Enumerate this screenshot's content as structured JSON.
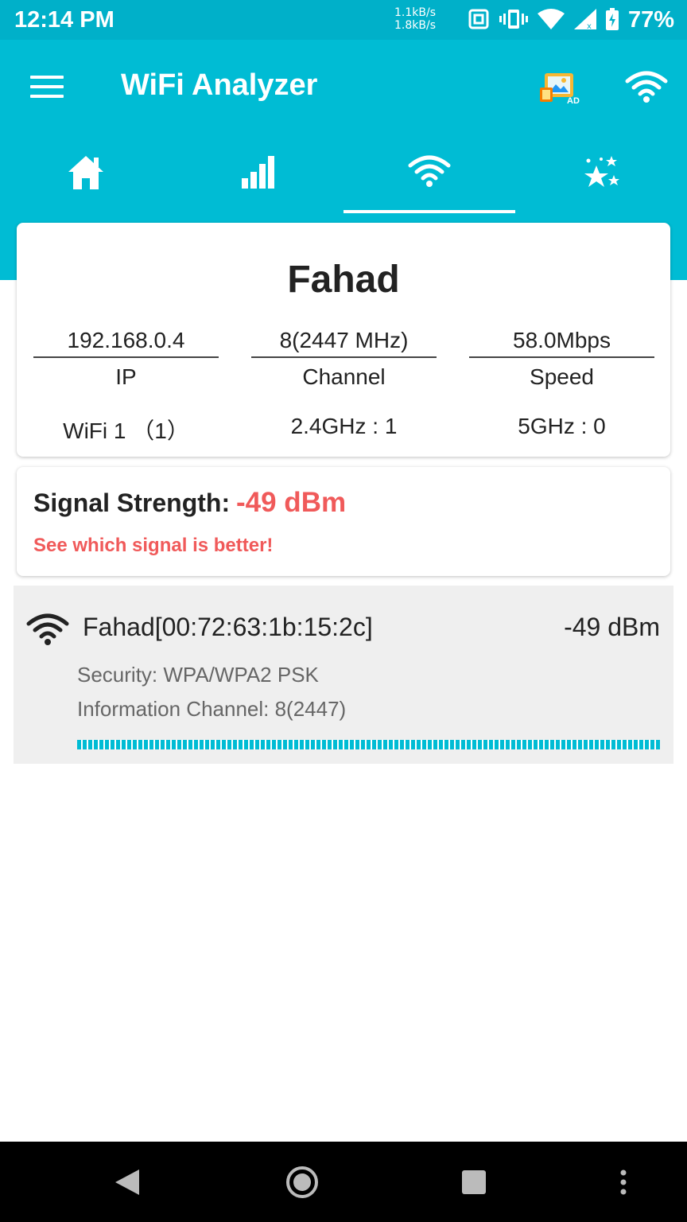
{
  "status_bar": {
    "time": "12:14 PM",
    "up_rate": "1.1kB/s",
    "down_rate": "1.8kB/s",
    "battery_percent": "77%",
    "icons": [
      "nfc-icon",
      "vibrate-icon",
      "wifi-signal-icon",
      "cell-signal-icon",
      "battery-icon"
    ]
  },
  "app_bar": {
    "title": "WiFi Analyzer",
    "ad_badge": "AD",
    "color": "#00bcd4"
  },
  "tabs": [
    {
      "name": "home",
      "icon": "home-icon"
    },
    {
      "name": "signal",
      "icon": "bar-chart-icon"
    },
    {
      "name": "wifi",
      "icon": "wifi-icon",
      "selected": true
    },
    {
      "name": "rate",
      "icon": "stars-icon"
    }
  ],
  "connection": {
    "ssid": "Fahad",
    "ip": "192.168.0.4",
    "ip_label": "IP",
    "channel": "8(2447 MHz)",
    "channel_label": "Channel",
    "speed": "58.0Mbps",
    "speed_label": "Speed",
    "wifi_count": "WiFi 1 （1）",
    "band_24": "2.4GHz : 1",
    "band_5": "5GHz : 0"
  },
  "signal": {
    "label": "Signal Strength:",
    "value": "-49 dBm",
    "hint": "See which signal is better!",
    "accent": "#f05a5a"
  },
  "access_points": [
    {
      "name": "Fahad[00:72:63:1b:15:2c]",
      "dbm": "-49 dBm",
      "security": "Security: WPA/WPA2 PSK",
      "channel": "Information Channel: 8(2447)",
      "strength_fraction": 1.0
    }
  ]
}
